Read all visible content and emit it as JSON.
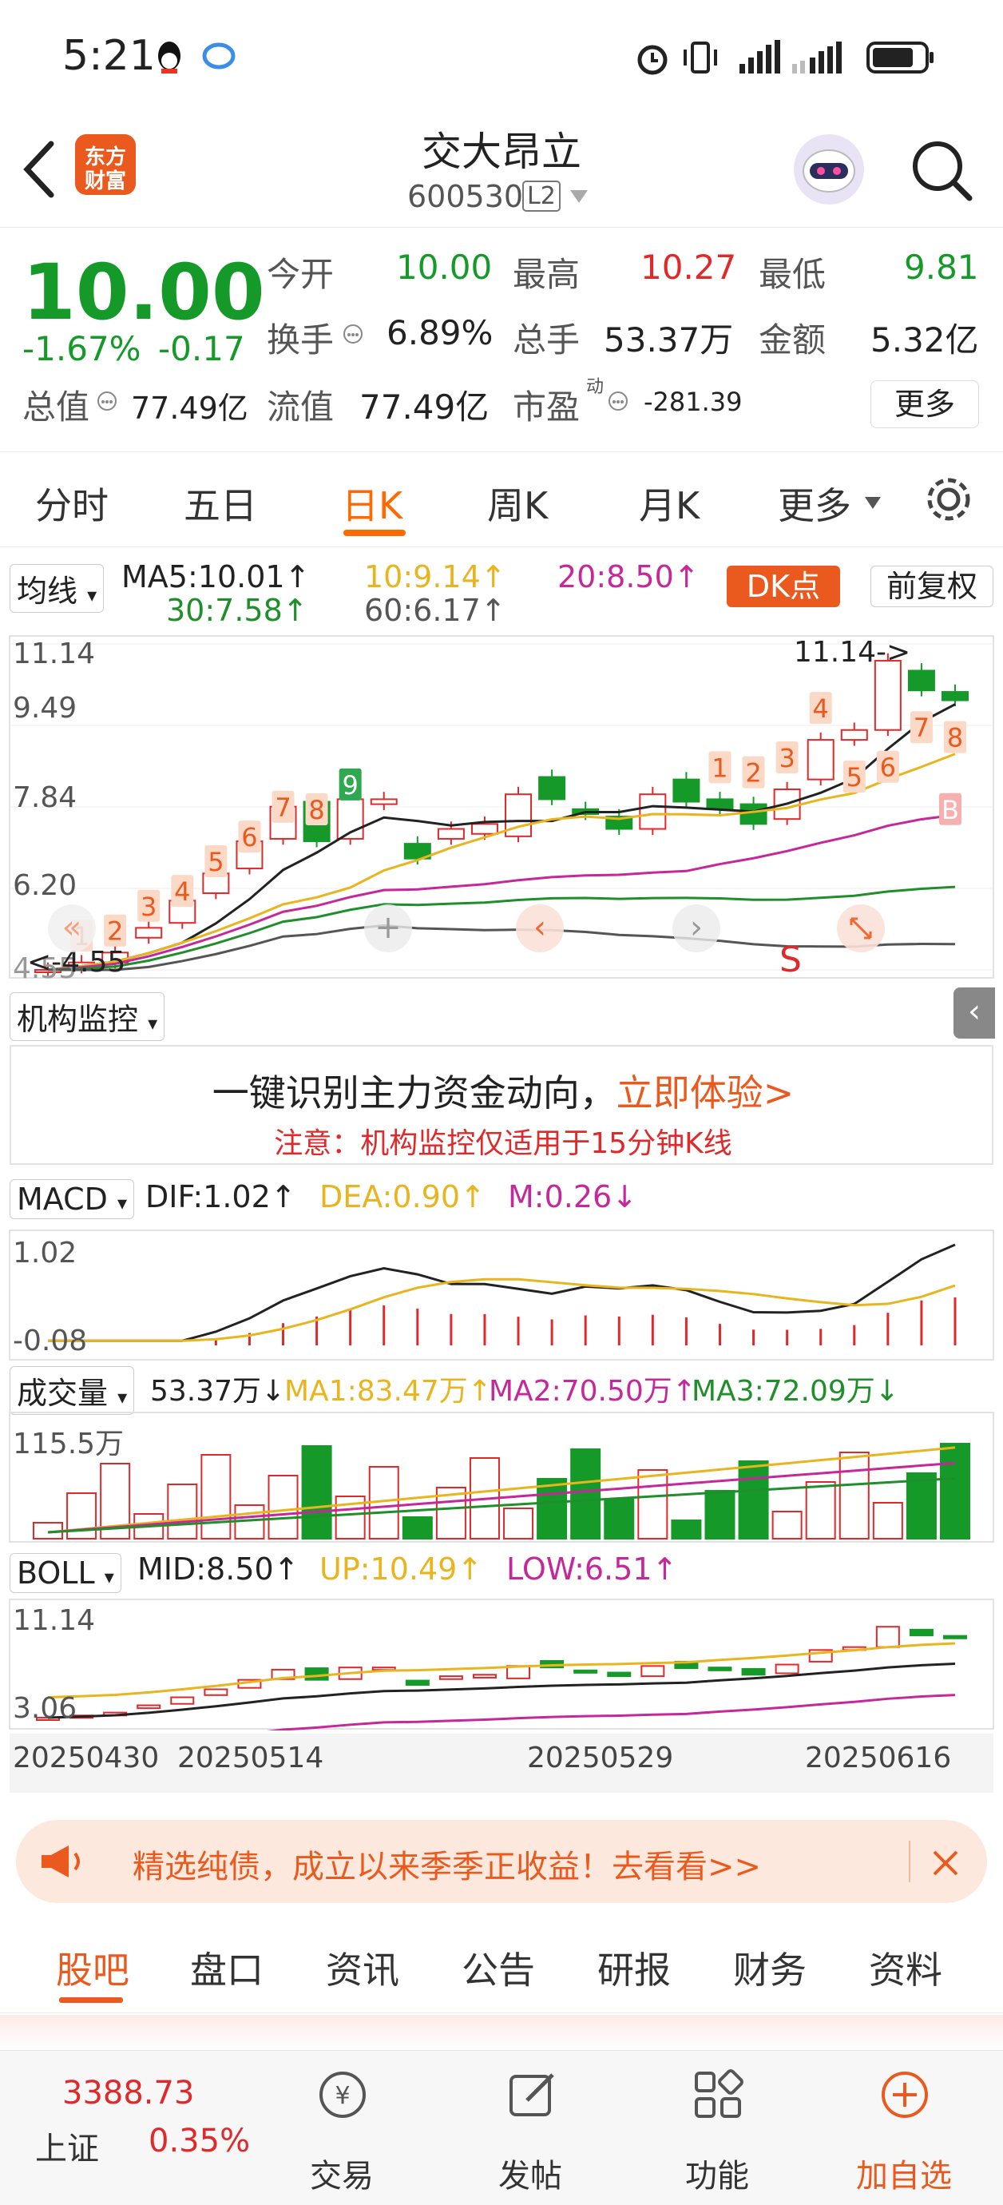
{
  "status_bar": {
    "time": "5:21"
  },
  "header": {
    "title": "交大昂立",
    "code": "600530",
    "level": "L2",
    "logo_line1": "东方",
    "logo_line2": "财富"
  },
  "quote": {
    "price": "10.00",
    "change_pct": "-1.67%",
    "change": "-0.17",
    "open_label": "今开",
    "open": "10.00",
    "high_label": "最高",
    "high": "10.27",
    "low_label": "最低",
    "low": "9.81",
    "turnover_label": "换手",
    "turnover": "6.89%",
    "volume_label": "总手",
    "volume": "53.37万",
    "amount_label": "金额",
    "amount": "5.32亿",
    "total_cap_label": "总值",
    "total_cap": "77.49亿",
    "float_cap_label": "流值",
    "float_cap": "77.49亿",
    "pe_label": "市盈",
    "pe_sup": "动",
    "pe": "-281.39",
    "more_label": "更多"
  },
  "tabs": [
    "分时",
    "五日",
    "日K",
    "周K",
    "月K",
    "更多"
  ],
  "active_tab": "日K",
  "ma": {
    "selector": "均线",
    "ma5": "MA5:10.01↑",
    "ma10": "10:9.14↑",
    "ma20": "20:8.50↑",
    "ma30": "30:7.58↑",
    "ma60": "60:6.17↑",
    "dk": "DK点",
    "adjust": "前复权"
  },
  "kline": {
    "y_labels": [
      "11.14",
      "9.49",
      "7.84",
      "6.20",
      "4.55"
    ],
    "max_label": "11.14->",
    "min_label": "<-4.55",
    "markers_up": [
      "1",
      "2",
      "3",
      "4",
      "5",
      "6",
      "7",
      "8"
    ],
    "marker_green": "9",
    "markers_up2": [
      "1",
      "2",
      "3",
      "4"
    ],
    "markers_down": [
      "5",
      "6",
      "7",
      "8"
    ],
    "buy_marker": "B",
    "sell_marker": "S"
  },
  "chart_data": {
    "type": "candlestick",
    "title": "",
    "x_labels": [
      "20250430",
      "20250514",
      "20250529",
      "20250616"
    ],
    "ylim": [
      4.55,
      11.14
    ],
    "candles": [
      {
        "o": 4.55,
        "c": 4.55
      },
      {
        "o": 4.6,
        "c": 4.7
      },
      {
        "o": 4.7,
        "c": 4.9
      },
      {
        "o": 5.2,
        "c": 5.4
      },
      {
        "o": 5.5,
        "c": 5.95
      },
      {
        "o": 6.1,
        "c": 6.5
      },
      {
        "o": 6.6,
        "c": 7.15
      },
      {
        "o": 7.2,
        "c": 7.85
      },
      {
        "o": 7.95,
        "c": 7.15
      },
      {
        "o": 7.2,
        "c": 8.0
      },
      {
        "o": 7.9,
        "c": 8.0
      },
      {
        "o": 7.1,
        "c": 6.8
      },
      {
        "o": 7.2,
        "c": 7.4
      },
      {
        "o": 7.3,
        "c": 7.5
      },
      {
        "o": 7.25,
        "c": 8.1
      },
      {
        "o": 8.45,
        "c": 8.0
      },
      {
        "o": 7.8,
        "c": 7.7
      },
      {
        "o": 7.65,
        "c": 7.4
      },
      {
        "o": 7.4,
        "c": 8.1
      },
      {
        "o": 8.4,
        "c": 7.95
      },
      {
        "o": 8.0,
        "c": 7.8
      },
      {
        "o": 7.9,
        "c": 7.5
      },
      {
        "o": 7.6,
        "c": 8.2
      },
      {
        "o": 8.4,
        "c": 9.2
      },
      {
        "o": 9.2,
        "c": 9.4
      },
      {
        "o": 9.4,
        "c": 10.8
      },
      {
        "o": 10.6,
        "c": 10.2
      },
      {
        "o": 10.17,
        "c": 10.0
      }
    ],
    "macd": {
      "dif": "DIF:1.02↑",
      "dea": "DEA:0.90↑",
      "m": "M:0.26↓",
      "y_labels": [
        "1.02",
        "-0.08"
      ]
    },
    "volume": {
      "label": "成交量",
      "value": "53.37万↓",
      "ma1": "MA1:83.47万↑",
      "ma2": "MA2:70.50万↑",
      "ma3": "MA3:72.09万↓",
      "y_label": "115.5万"
    },
    "boll": {
      "label": "BOLL",
      "mid": "MID:8.50↑",
      "up": "UP:10.49↑",
      "low": "LOW:6.51↑",
      "y_labels": [
        "11.14",
        "3.06"
      ]
    }
  },
  "inst": {
    "selector": "机构监控",
    "headline": "一键识别主力资金动向，",
    "cta": "立即体验>",
    "note": "注意：机构监控仅适用于15分钟K线"
  },
  "macd_selector": "MACD",
  "promo": {
    "text": "精选纯债，成立以来季季正收益！去看看>>"
  },
  "bottom_tabs": [
    "股吧",
    "盘口",
    "资讯",
    "公告",
    "研报",
    "财务",
    "资料"
  ],
  "active_bottom_tab": "股吧",
  "nav": {
    "index_value": "3388.73",
    "index_name": "上证",
    "index_change": "0.35%",
    "trade": "交易",
    "post": "发帖",
    "func": "功能",
    "add": "加自选"
  },
  "colors": {
    "up": "#e0292b",
    "down": "#159a2a",
    "accent": "#ff6a00",
    "ma5": "#222222",
    "ma10": "#e9b51e",
    "ma20": "#c4289a",
    "ma30": "#1e8f2a",
    "ma60": "#555555"
  }
}
